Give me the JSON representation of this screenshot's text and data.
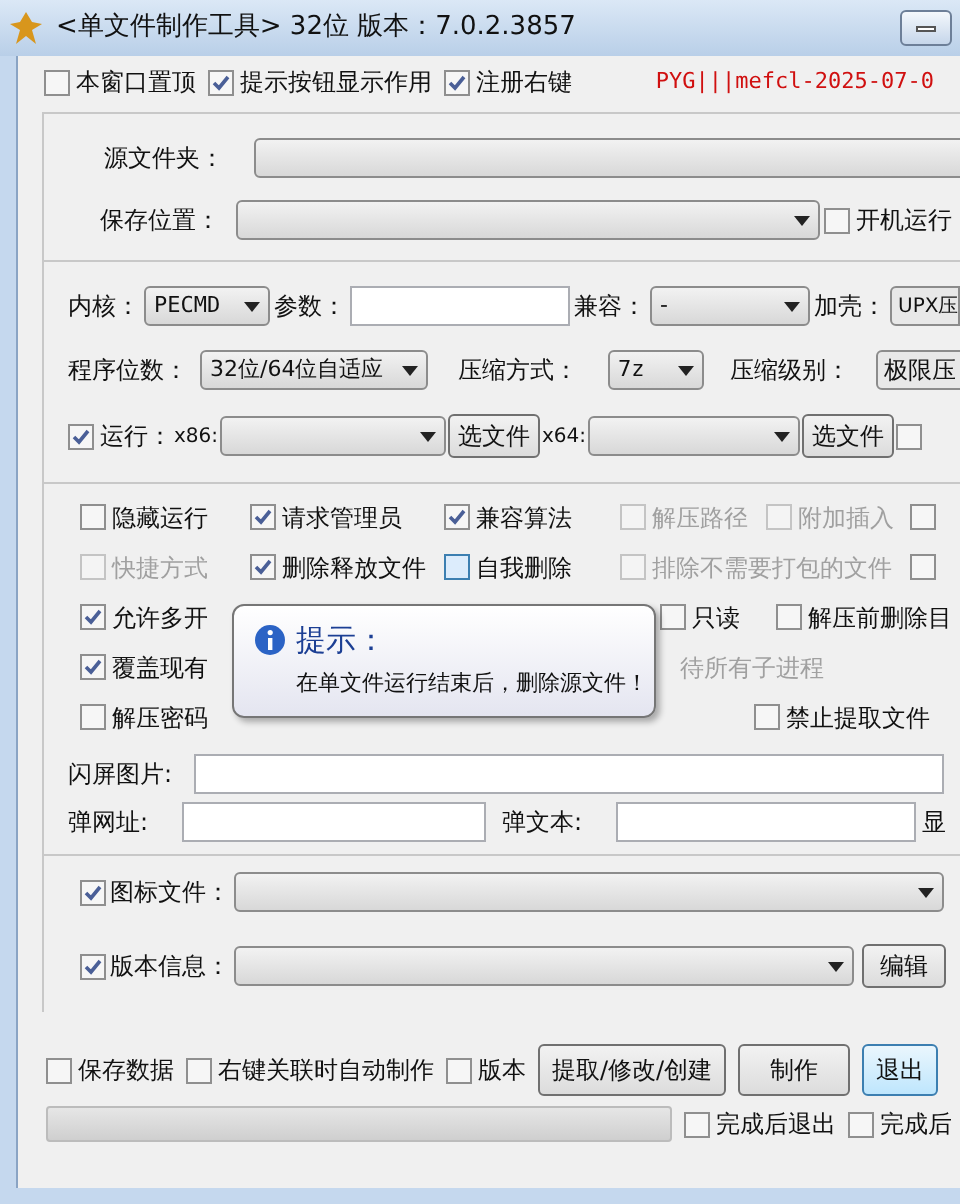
{
  "window": {
    "title": "<单文件制作工具> 32位  版本：7.0.2.3857"
  },
  "top_options": [
    {
      "label": "本窗口置顶",
      "checked": false
    },
    {
      "label": "提示按钮显示作用",
      "checked": true
    },
    {
      "label": "注册右键",
      "checked": true
    }
  ],
  "signature": "PYG|||mefcl-2025-07-0",
  "source_folder": {
    "label": "源文件夹："
  },
  "save_location": {
    "label": "保存位置：",
    "autostart": {
      "label": "开机运行",
      "checked": false
    }
  },
  "core": {
    "label": "内核：",
    "value": "PECMD"
  },
  "params": {
    "label": "参数："
  },
  "compat": {
    "label": "兼容：",
    "value": "-"
  },
  "packer": {
    "label": "加壳：",
    "value": "UPX压"
  },
  "bits": {
    "label": "程序位数：",
    "value": "32位/64位自适应"
  },
  "compress_method": {
    "label": "压缩方式：",
    "value": "7z"
  },
  "compress_level": {
    "label": "压缩级别：",
    "value": "极限压"
  },
  "run": {
    "label": "运行：",
    "checked": true,
    "x86_label": "x86:",
    "x64_label": "x64:",
    "buttons": [
      "选文件",
      "选文件"
    ],
    "extra_checked": false
  },
  "option_rows": [
    [
      {
        "label": "隐藏运行",
        "checked": false,
        "disabled": false
      },
      {
        "label": "请求管理员",
        "checked": true,
        "disabled": false
      },
      {
        "label": "兼容算法",
        "checked": true,
        "disabled": false
      },
      {
        "label": "解压路径",
        "checked": false,
        "disabled": true
      },
      {
        "label": "附加插入",
        "checked": false,
        "disabled": true
      },
      {
        "checked": false,
        "disabled": false
      }
    ],
    [
      {
        "label": "快捷方式",
        "checked": false,
        "disabled": true
      },
      {
        "label": "删除释放文件",
        "checked": true,
        "disabled": false
      },
      {
        "label": "自我删除",
        "checked": false,
        "disabled": false
      },
      {
        "label": "排除不需要打包的文件",
        "checked": false,
        "disabled": true
      },
      {
        "checked": false,
        "disabled": false
      }
    ],
    [
      {
        "label": "允许多开",
        "checked": true,
        "disabled": false
      },
      {
        "label": "只读",
        "checked": false,
        "disabled": false
      },
      {
        "label": "解压前删除目",
        "checked": false,
        "disabled": false
      }
    ],
    [
      {
        "label": "覆盖现有",
        "checked": true,
        "disabled": false
      },
      {
        "label": "待所有子进程",
        "disabled": true
      }
    ],
    [
      {
        "label": "解压密码",
        "checked": false,
        "disabled": false
      },
      {
        "label": "禁止提取文件",
        "checked": false,
        "disabled": false
      }
    ]
  ],
  "tooltip": {
    "title": "提示：",
    "text": "在单文件运行结束后，删除源文件！"
  },
  "splash": {
    "label": "闪屏图片:"
  },
  "popup_url": {
    "label": "弹网址:"
  },
  "popup_text": {
    "label": "弹文本:"
  },
  "show_label": "显",
  "icon_file": {
    "label": "图标文件：",
    "checked": true
  },
  "version_info": {
    "label": "版本信息：",
    "checked": true,
    "button": "编辑"
  },
  "bottom_options": [
    {
      "label": "保存数据",
      "checked": false
    },
    {
      "label": "右键关联时自动制作",
      "checked": false
    },
    {
      "label": "版本",
      "checked": false
    }
  ],
  "buttons": [
    {
      "label": "提取/修改/创建",
      "focused": false
    },
    {
      "label": "制作",
      "focused": false
    },
    {
      "label": "退出",
      "focused": true
    }
  ],
  "progress": {
    "level": 0
  },
  "finish_options": [
    {
      "label": "完成后退出",
      "checked": false
    },
    {
      "label": "完成后",
      "checked": false
    }
  ]
}
